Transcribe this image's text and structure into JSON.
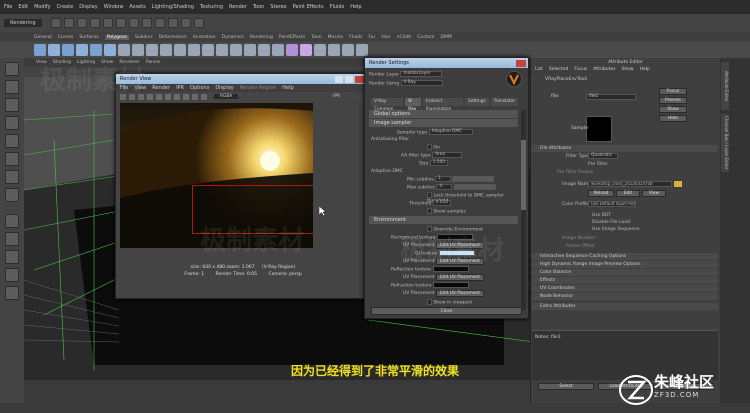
{
  "menubar": {
    "items": [
      "File",
      "Edit",
      "Modify",
      "Create",
      "Display",
      "Window",
      "Assets",
      "Lighting/Shading",
      "Texturing",
      "Render",
      "Toon",
      "Stereo",
      "Paint Effects",
      "Fluids",
      "Help"
    ],
    "mode": "Rendering"
  },
  "shelf": {
    "tabs": [
      "General",
      "Curves",
      "Surfaces",
      "Polygons",
      "Subdivs",
      "Deformation",
      "Animation",
      "Dynamics",
      "Rendering",
      "PaintEffects",
      "Toon",
      "Muscle",
      "Fluids",
      "Fur",
      "Hair",
      "nCloth",
      "Custom",
      "DMM"
    ],
    "active": "Polygons"
  },
  "viewport": {
    "menu": [
      "View",
      "Shading",
      "Lighting",
      "Show",
      "Renderer",
      "Panels"
    ]
  },
  "render_view": {
    "title": "Render View",
    "menu": [
      "File",
      "View",
      "Render",
      "IPR",
      "Options",
      "Display",
      "Render Region",
      "Help"
    ],
    "size_label": "size: 640 x 480 zoom: 1.067",
    "region_label": "(V-Ray Region)",
    "frame_label": "Frame: 1",
    "time_label": "Render Time: 0:05",
    "camera_label": "Camera: persp",
    "mode_select": "RGBA",
    "right_tools": "IPR"
  },
  "render_settings": {
    "title": "Render Settings",
    "render_layer_label": "Render Layer",
    "render_layer": "masterLayer",
    "render_using_label": "Render Using",
    "render_using": "V-Ray",
    "tabs": [
      "V-Ray Common",
      "V-Ray",
      "Indirect Illumination",
      "Settings",
      "Translator"
    ],
    "active_tab": "V-Ray",
    "global_options": "Global options",
    "image_sampler": "Image sampler",
    "sampler_type_label": "Sampler type",
    "sampler_type": "Adaptive DMC",
    "antialiasing_label": "Antialiasing filter",
    "on_label": "On",
    "aa_filter_label": "AA filter type",
    "aa_filter": "Area",
    "size_label": "Size",
    "size": "1.500",
    "adaptive_dmc": "Adaptive DMC",
    "min_subdivs_label": "Min subdivs",
    "min_subdivs": "1",
    "max_subdivs_label": "Max subdivs",
    "max_subdivs": "4",
    "lock_threshold": "Lock threshold to DMC sampler threshold",
    "threshold_label": "Threshold",
    "threshold": "0.010",
    "show_samples": "Show samples",
    "environment": "Environment",
    "override_env": "Override Environment",
    "bg_texture_label": "Background texture",
    "uv_placement_label": "UV Placement",
    "edit_uv": "Edit UV Placement",
    "gi_texture_label": "GI texture",
    "reflection_label": "Reflection texture",
    "refraction_label": "Refraction texture",
    "show_viewport": "Show in viewport",
    "close_button": "Close"
  },
  "attribute_editor": {
    "title": "Attribute Editor",
    "menu": [
      "List",
      "Selected",
      "Focus",
      "Attributes",
      "Show",
      "Help"
    ],
    "node_tab": "VRayPlaceEnvTex4",
    "focus_btn": "Focus",
    "presets_btn": "Presets",
    "show_btn": "Show",
    "hide_btn": "Hide",
    "file_label": "file:",
    "file_value": "file1",
    "sample_label": "Sample",
    "file_attributes": "File Attributes",
    "filter_type_label": "Filter Type",
    "filter_type": "Quadratic",
    "pre_filter": "Pre Filter",
    "pre_filter_radius": "Pre Filter Radius",
    "image_name_label": "Image Name",
    "image_name": "workshop_cross_20120314.hdr",
    "reload_btn": "Reload",
    "edit_btn": "Edit",
    "view_btn": "View",
    "color_profile_label": "Color Profile",
    "color_profile": "Use Default Input Profile",
    "use_bot": "Use BOT",
    "disable_file_load": "Disable File Load",
    "use_image_seq": "Use Image Sequence",
    "image_number": "Image Number",
    "frame_offset": "Frame Offset",
    "sections": [
      "Interactive Sequence Caching Options",
      "High Dynamic Range Image Preview Options",
      "Color Balance",
      "Effects",
      "UV Coordinates",
      "Node Behavior",
      "Extra Attributes"
    ],
    "notes_label": "Notes: file1",
    "select_btn": "Select",
    "load_btn": "Load Attributes",
    "copy_btn": "Copy Tab",
    "side_tabs": [
      "Attribute Editor",
      "Channel Box / Layer Editor"
    ]
  },
  "subtitle": "因为已经得到了非常平滑的效果",
  "watermark": {
    "brand": "朱峰社区",
    "url": "ZF3D.COM",
    "bg_text": "极制素材"
  },
  "colors": {
    "region": "#b01818",
    "subtitle": "#f0e020",
    "title_bar": "#a9c5e3"
  }
}
